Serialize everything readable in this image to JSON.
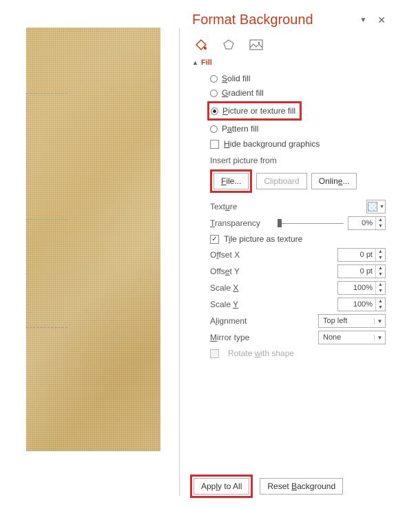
{
  "panel": {
    "title": "Format Background",
    "icons": {
      "fill": "bucket-icon",
      "effects": "pentagon-icon",
      "picture": "picture-icon"
    }
  },
  "fill": {
    "section_label": "Fill",
    "options": {
      "solid": "Solid fill",
      "gradient": "Gradient fill",
      "picture": "Picture or texture fill",
      "pattern": "Pattern fill"
    },
    "hide_bg": "Hide background graphics",
    "insert_label": "Insert picture from",
    "buttons": {
      "file": "File...",
      "clipboard": "Clipboard",
      "online": "Online..."
    },
    "texture_label": "Texture",
    "transparency_label": "Transparency",
    "transparency_value": "0%",
    "tile_label": "Tile picture as texture",
    "offset_x_label": "Offset X",
    "offset_x_value": "0 pt",
    "offset_y_label": "Offset Y",
    "offset_y_value": "0 pt",
    "scale_x_label": "Scale X",
    "scale_x_value": "100%",
    "scale_y_label": "Scale Y",
    "scale_y_value": "100%",
    "alignment_label": "Alignment",
    "alignment_value": "Top left",
    "mirror_label": "Mirror type",
    "mirror_value": "None",
    "rotate_label": "Rotate with shape"
  },
  "footer": {
    "apply_all": "Apply to All",
    "reset": "Reset Background"
  }
}
